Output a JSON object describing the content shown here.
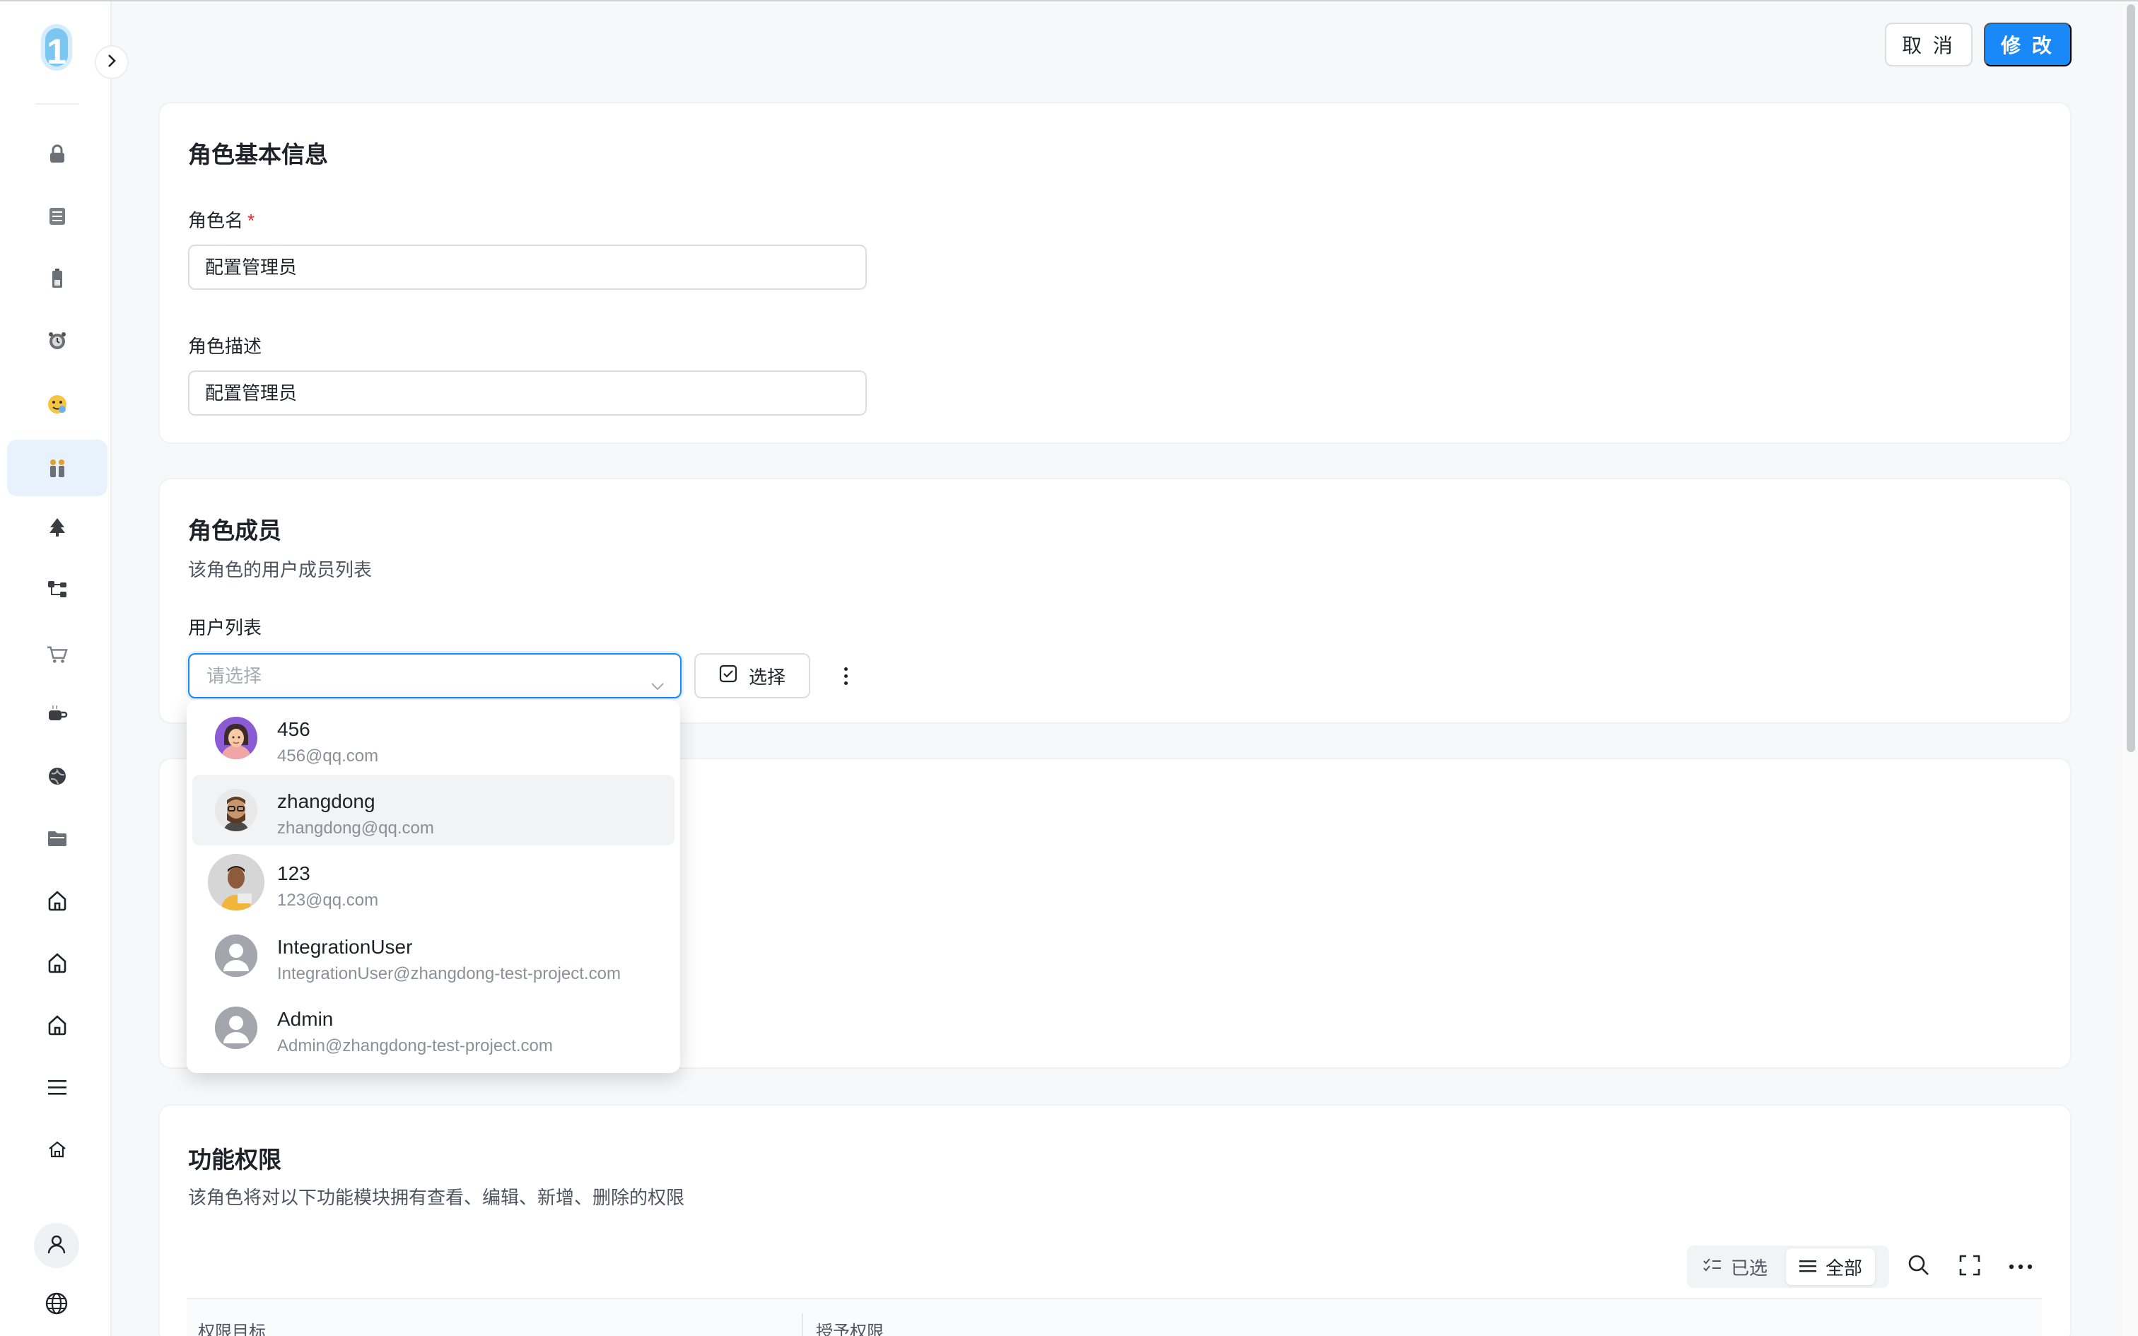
{
  "app": {
    "logo_text": "1",
    "accent": "#1989fa"
  },
  "sidebar": {
    "items": [
      {
        "icon": "lock-icon",
        "active": false
      },
      {
        "icon": "list-icon",
        "active": false
      },
      {
        "icon": "battery-icon",
        "active": false
      },
      {
        "icon": "alarm-clock-icon",
        "active": false
      },
      {
        "icon": "emoji-face-icon",
        "active": false
      },
      {
        "icon": "people-icon",
        "active": true
      },
      {
        "icon": "tree-icon",
        "active": false
      },
      {
        "icon": "hierarchy-icon",
        "active": false
      },
      {
        "icon": "cart-icon",
        "active": false
      },
      {
        "icon": "coffee-icon",
        "active": false
      },
      {
        "icon": "globe-dark-icon",
        "active": false
      },
      {
        "icon": "folder-icon",
        "active": false
      },
      {
        "icon": "home-icon",
        "active": false
      },
      {
        "icon": "home-icon",
        "active": false
      },
      {
        "icon": "home-icon",
        "active": false
      },
      {
        "icon": "menu-icon",
        "active": false
      },
      {
        "icon": "home-small-icon",
        "active": false
      }
    ]
  },
  "toolbar": {
    "cancel_label": "取 消",
    "save_label": "修 改"
  },
  "basic_info": {
    "title": "角色基本信息",
    "name_label": "角色名",
    "required_mark": "*",
    "name_value": "配置管理员",
    "desc_label": "角色描述",
    "desc_value": "配置管理员"
  },
  "members": {
    "title": "角色成员",
    "subtitle": "该角色的用户成员列表",
    "user_list_label": "用户列表",
    "select_placeholder": "请选择",
    "choose_label": "选择",
    "options": [
      {
        "name": "456",
        "email": "456@qq.com",
        "avatar": "woman-avatar"
      },
      {
        "name": "zhangdong",
        "email": "zhangdong@qq.com",
        "avatar": "man-glasses-avatar"
      },
      {
        "name": "123",
        "email": "123@qq.com",
        "avatar": "man-laptop-avatar"
      },
      {
        "name": "IntegrationUser",
        "email": "IntegrationUser@zhangdong-test-project.com",
        "avatar": "default-avatar"
      },
      {
        "name": "Admin",
        "email": "Admin@zhangdong-test-project.com",
        "avatar": "default-avatar"
      }
    ]
  },
  "permissions": {
    "title": "功能权限",
    "subtitle": "该角色将对以下功能模块拥有查看、编辑、新增、删除的权限",
    "seg_selected": "已选",
    "seg_all": "全部",
    "col_target": "权限目标",
    "col_grant": "授予权限"
  }
}
